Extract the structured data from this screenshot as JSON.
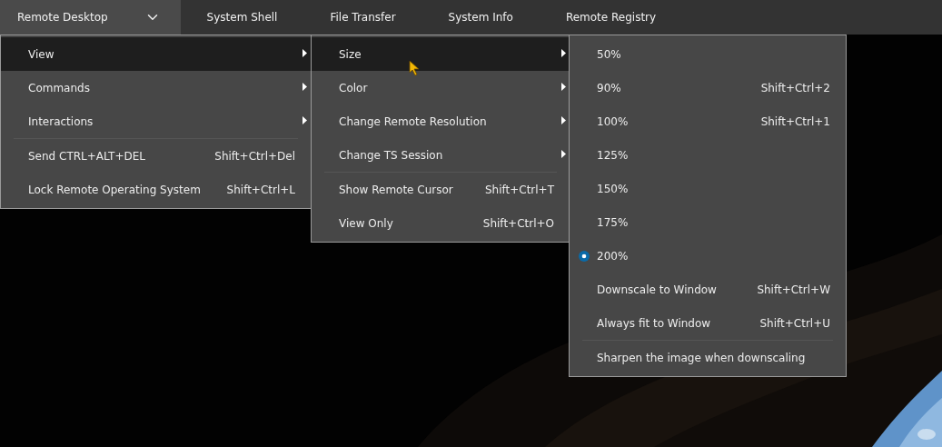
{
  "menubar": [
    {
      "label": "Remote Desktop",
      "selected": true,
      "dropdown": true
    },
    {
      "label": "System Shell",
      "selected": false,
      "dropdown": false
    },
    {
      "label": "File Transfer",
      "selected": false,
      "dropdown": false
    },
    {
      "label": "System Info",
      "selected": false,
      "dropdown": false
    },
    {
      "label": "Remote Registry",
      "selected": false,
      "dropdown": false
    }
  ],
  "menus": [
    {
      "items": [
        {
          "kind": "submenu",
          "label": "View",
          "selected": true,
          "separator_before": false
        },
        {
          "kind": "submenu",
          "label": "Commands",
          "selected": false,
          "separator_before": false
        },
        {
          "kind": "submenu",
          "label": "Interactions",
          "selected": false,
          "separator_before": false
        },
        {
          "kind": "command",
          "label": "Send CTRL+ALT+DEL",
          "shortcut": "Shift+Ctrl+Del",
          "selected": false,
          "separator_before": true
        },
        {
          "kind": "command",
          "label": "Lock Remote Operating System",
          "shortcut": "Shift+Ctrl+L",
          "selected": false,
          "separator_before": false
        }
      ]
    },
    {
      "items": [
        {
          "kind": "submenu",
          "label": "Size",
          "selected": true,
          "separator_before": false
        },
        {
          "kind": "submenu",
          "label": "Color",
          "selected": false,
          "separator_before": false
        },
        {
          "kind": "submenu",
          "label": "Change Remote Resolution",
          "selected": false,
          "separator_before": false
        },
        {
          "kind": "submenu",
          "label": "Change TS Session",
          "selected": false,
          "separator_before": false
        },
        {
          "kind": "command",
          "label": "Show Remote Cursor",
          "shortcut": "Shift+Ctrl+T",
          "selected": false,
          "separator_before": true
        },
        {
          "kind": "command",
          "label": "View Only",
          "shortcut": "Shift+Ctrl+O",
          "selected": false,
          "separator_before": false
        }
      ]
    },
    {
      "items": [
        {
          "kind": "radio",
          "label": "50%",
          "checked": false,
          "selected": false,
          "separator_before": false
        },
        {
          "kind": "radio",
          "label": "90%",
          "shortcut": "Shift+Ctrl+2",
          "checked": false,
          "selected": false,
          "separator_before": false
        },
        {
          "kind": "radio",
          "label": "100%",
          "shortcut": "Shift+Ctrl+1",
          "checked": false,
          "selected": false,
          "separator_before": false
        },
        {
          "kind": "radio",
          "label": "125%",
          "checked": false,
          "selected": false,
          "separator_before": false
        },
        {
          "kind": "radio",
          "label": "150%",
          "checked": false,
          "selected": false,
          "separator_before": false
        },
        {
          "kind": "radio",
          "label": "175%",
          "checked": false,
          "selected": false,
          "separator_before": false
        },
        {
          "kind": "radio",
          "label": "200%",
          "checked": true,
          "selected": false,
          "separator_before": false
        },
        {
          "kind": "command",
          "label": "Downscale to Window",
          "shortcut": "Shift+Ctrl+W",
          "selected": false,
          "separator_before": false
        },
        {
          "kind": "command",
          "label": "Always fit to Window",
          "shortcut": "Shift+Ctrl+U",
          "selected": false,
          "separator_before": false
        },
        {
          "kind": "command",
          "label": "Sharpen the image when downscaling",
          "selected": false,
          "separator_before": true
        }
      ]
    }
  ]
}
